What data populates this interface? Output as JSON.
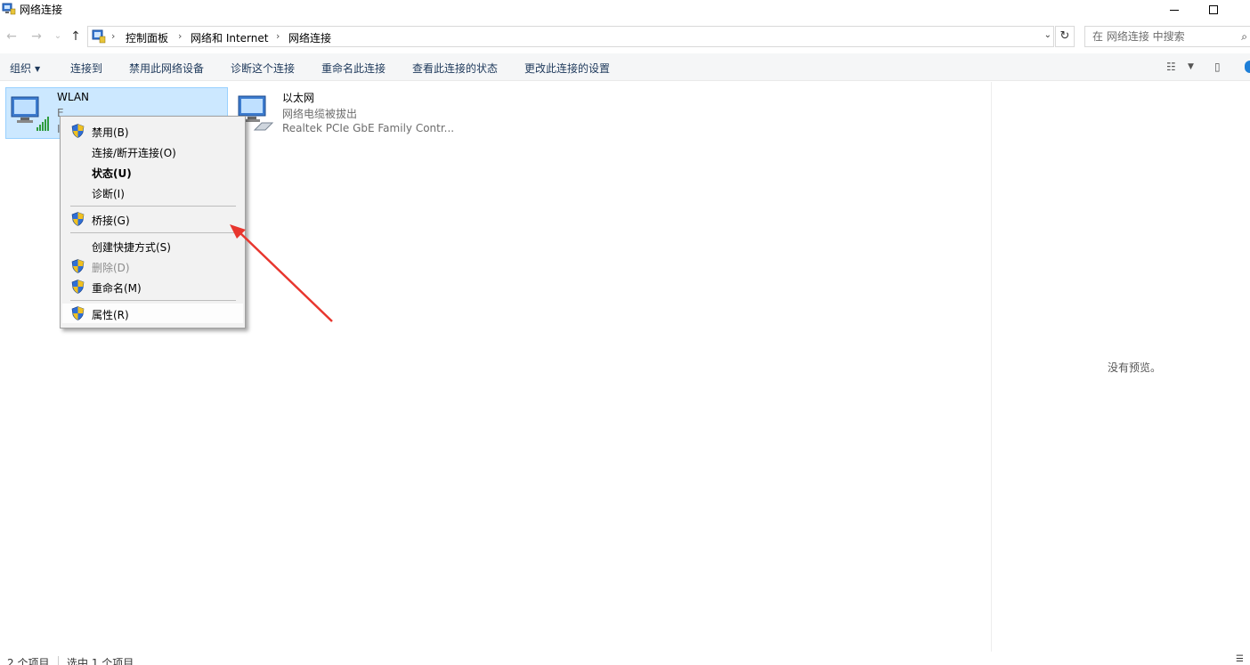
{
  "window": {
    "title": "网络连接"
  },
  "address_bar": {
    "crumbs": [
      "控制面板",
      "网络和 Internet",
      "网络连接"
    ],
    "search_placeholder": "在 网络连接 中搜索"
  },
  "commands": {
    "organize": "组织",
    "connect_to": "连接到",
    "disable_device": "禁用此网络设备",
    "diagnose": "诊断这个连接",
    "rename": "重命名此连接",
    "view_status": "查看此连接的状态",
    "change_settings": "更改此连接的设置"
  },
  "connections": [
    {
      "name": "WLAN",
      "line2": "E",
      "line3": "I",
      "selected": true,
      "icon": "wifi-adapter-icon"
    },
    {
      "name": "以太网",
      "line2": "网络电缆被拔出",
      "line3": "Realtek PCIe GbE Family Contr...",
      "selected": false,
      "icon": "ethernet-adapter-icon"
    }
  ],
  "context_menu": {
    "items": [
      {
        "label": "禁用(B)",
        "shield": true
      },
      {
        "label": "连接/断开连接(O)",
        "shield": false
      },
      {
        "label": "状态(U)",
        "shield": false,
        "bold": true
      },
      {
        "label": "诊断(I)",
        "shield": false
      },
      {
        "label": "桥接(G)",
        "shield": true
      },
      {
        "label": "创建快捷方式(S)",
        "shield": false
      },
      {
        "label": "删除(D)",
        "shield": true,
        "disabled": true
      },
      {
        "label": "重命名(M)",
        "shield": true
      },
      {
        "label": "属性(R)",
        "shield": true,
        "highlighted": true
      }
    ]
  },
  "preview": {
    "empty_text": "没有预览。"
  },
  "status": {
    "item_count": "2 个项目",
    "selected_count": "选中 1 个项目"
  },
  "colors": {
    "selection": "#cce8ff",
    "command_text": "#1e395b",
    "annotation_arrow": "#e8362e"
  }
}
